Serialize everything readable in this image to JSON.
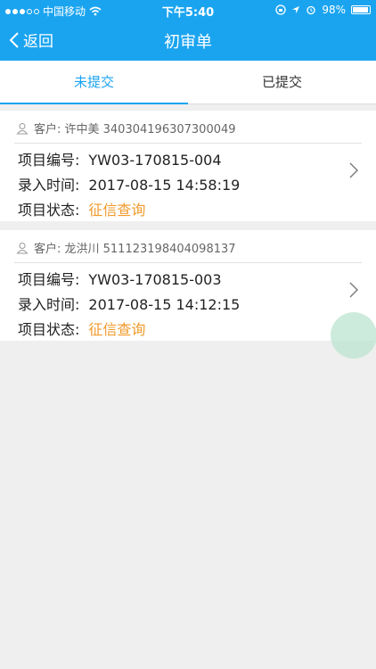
{
  "status_bar": {
    "carrier": "中国移动",
    "time": "下午5:40",
    "battery": "98%"
  },
  "nav": {
    "back_label": "返回",
    "title": "初审单"
  },
  "tabs": [
    {
      "label": "未提交",
      "active": true
    },
    {
      "label": "已提交",
      "active": false
    }
  ],
  "labels": {
    "project_no": "项目编号:",
    "entry_time": "录入时间:",
    "status": "项目状态:"
  },
  "cards": [
    {
      "customer": "客户: 许中美 340304196307300049",
      "project_no": "YW03-170815-004",
      "entry_time": "2017-08-15 14:58:19",
      "status": "征信查询"
    },
    {
      "customer": "客户: 龙洪川 511123198404098137",
      "project_no": "YW03-170815-003",
      "entry_time": "2017-08-15 14:12:15",
      "status": "征信查询"
    }
  ],
  "colors": {
    "primary": "#1aa4f0",
    "status": "#f19a2b"
  }
}
